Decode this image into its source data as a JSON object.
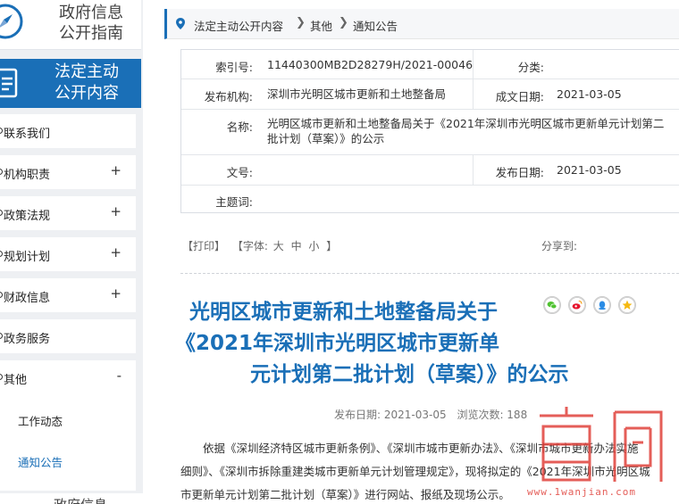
{
  "sidebar": {
    "guide_lines": [
      "政府信息",
      "公开指南"
    ],
    "law_lines": [
      "法定主动",
      "公开内容"
    ],
    "items": [
      {
        "label": "联系我们",
        "sign": ""
      },
      {
        "label": "机构职责",
        "sign": "+"
      },
      {
        "label": "政策法规",
        "sign": "+"
      },
      {
        "label": "规划计划",
        "sign": "+"
      },
      {
        "label": "财政信息",
        "sign": "+"
      },
      {
        "label": "政务服务",
        "sign": ""
      },
      {
        "label": "其他",
        "sign": "-"
      }
    ],
    "sub_items": [
      "工作动态",
      "通知公告"
    ],
    "last_item_partial": "政府信息",
    "accent_color": "#1a6fb7"
  },
  "breadcrumb": [
    "法定主动公开内容",
    "其他",
    "通知公告"
  ],
  "info_table": {
    "index_label": "索引号:",
    "index_value": "11440300MB2D28279H/2021-00046",
    "category_label": "分类:",
    "category_value": "",
    "org_label": "发布机构:",
    "org_value": "深圳市光明区城市更新和土地整备局",
    "created_label": "成文日期:",
    "created_value": "2021-03-05",
    "name_label": "名称:",
    "name_value_lines": [
      "光明区城市更新和土地整备局关于《2021年深圳市光明区城市更新单元计划第二",
      "批计划（草案）》的公示"
    ],
    "docno_label": "文号:",
    "docno_value": "",
    "published_label": "发布日期:",
    "published_value": "2021-03-05",
    "subject_label": "主题词:",
    "subject_value": ""
  },
  "tools": {
    "print": "【打印】",
    "font_label": "【字体:",
    "font_large": "大",
    "font_medium": "中",
    "font_small": "小",
    "font_close": "】",
    "share_label": "分享到:"
  },
  "article": {
    "title_lines": [
      "光明区城市更新和土地整备局关于",
      "《2021年深圳市光明区城市更新单",
      "元计划第二批计划（草案）》的公示"
    ],
    "publish_date": "发布日期: 2021-03-05",
    "views": "浏览次数: 188",
    "body_lines": [
      "依据《深圳经济特区城市更新条例》、《深圳市城市更新办法》、《深圳市城市更新办法实施",
      "细则》、《深圳市拆除重建类城市更新单元计划管理规定》，现将拟定的《2021年深圳市光明区城",
      "市更新单元计划第二批计划（草案）》进行网站、报纸及现场公示。"
    ]
  },
  "share_icons": [
    "wechat-icon",
    "weibo-icon",
    "qq-icon",
    "qzone-icon"
  ],
  "watermark": {
    "logo_text": "官网",
    "url": "www.1wanjian.com"
  }
}
